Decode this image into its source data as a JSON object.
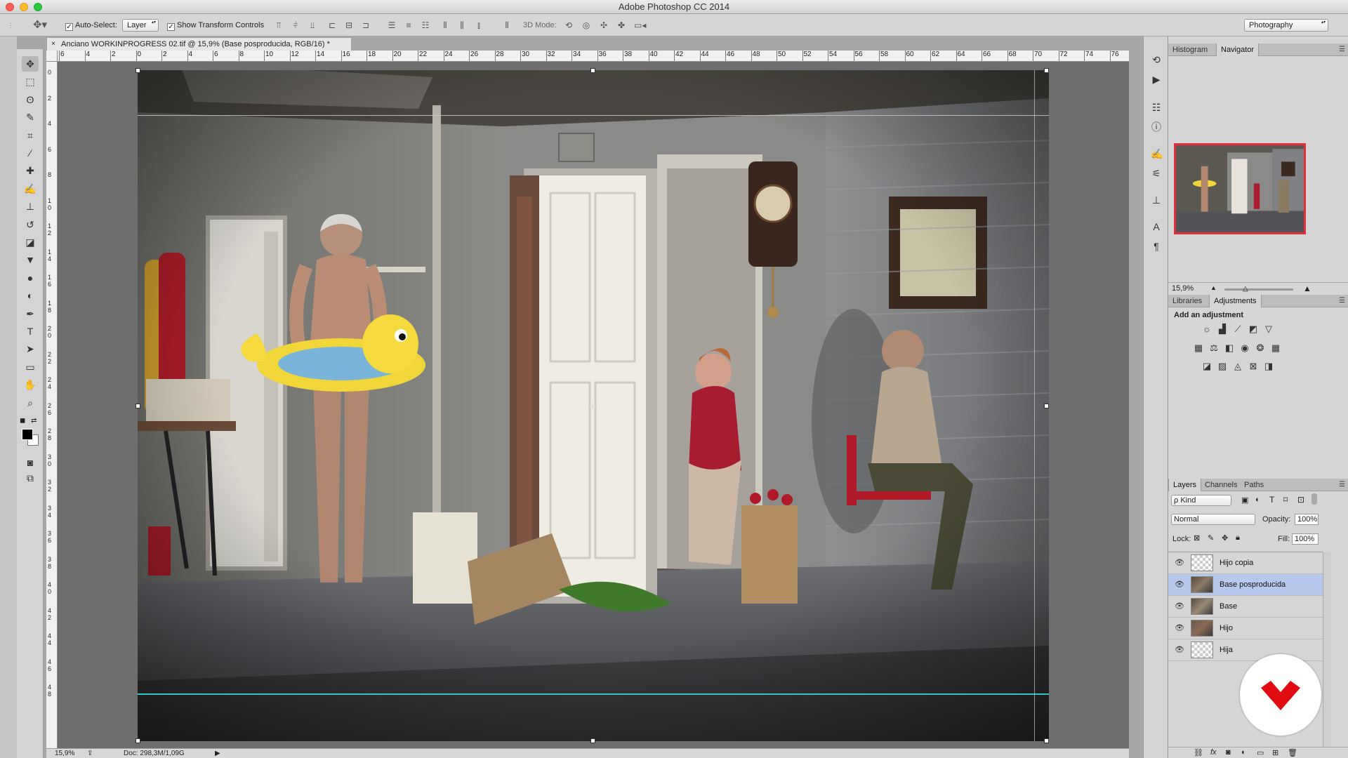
{
  "app": {
    "title": "Adobe Photoshop CC 2014"
  },
  "options_bar": {
    "auto_select_label": "Auto-Select:",
    "auto_select_checked": true,
    "auto_select_target": "Layer",
    "show_transform_label": "Show Transform Controls",
    "show_transform_checked": true,
    "mode_3d_label": "3D Mode:",
    "workspace": "Photography"
  },
  "document": {
    "tab_title": "Anciano WORKINPROGRESS 02.tif @ 15,9% (Base posproducida, RGB/16) *",
    "close_glyph": "×"
  },
  "ruler_h": [
    "6",
    "4",
    "2",
    "0",
    "2",
    "4",
    "6",
    "8",
    "10",
    "12",
    "14",
    "16",
    "18",
    "20",
    "22",
    "24",
    "26",
    "28",
    "30",
    "32",
    "34",
    "36",
    "38",
    "40",
    "42",
    "44",
    "46",
    "48",
    "50",
    "52",
    "54",
    "56",
    "58",
    "60",
    "62",
    "64",
    "66",
    "68",
    "70",
    "72",
    "74",
    "76"
  ],
  "ruler_v": [
    "0",
    "2",
    "4",
    "6",
    "8",
    "1\n0",
    "1\n2",
    "1\n4",
    "1\n6",
    "1\n8",
    "2\n0",
    "2\n2",
    "2\n4",
    "2\n6",
    "2\n8",
    "3\n0",
    "3\n2",
    "3\n4",
    "3\n6",
    "3\n8",
    "4\n0",
    "4\n2",
    "4\n4",
    "4\n6",
    "4\n8"
  ],
  "status_bar": {
    "zoom": "15,9%",
    "doc_info": "Doc: 298,3M/1,09G"
  },
  "tools": [
    {
      "name": "move-tool",
      "glyph": "✥"
    },
    {
      "name": "marquee-tool",
      "glyph": "⬚"
    },
    {
      "name": "lasso-tool",
      "glyph": "ʘ"
    },
    {
      "name": "quick-select-tool",
      "glyph": "✎"
    },
    {
      "name": "crop-tool",
      "glyph": "⌗"
    },
    {
      "name": "eyedropper-tool",
      "glyph": "⁄"
    },
    {
      "name": "healing-tool",
      "glyph": "✚"
    },
    {
      "name": "brush-tool",
      "glyph": "✍"
    },
    {
      "name": "stamp-tool",
      "glyph": "⊥"
    },
    {
      "name": "history-brush-tool",
      "glyph": "↺"
    },
    {
      "name": "eraser-tool",
      "glyph": "◪"
    },
    {
      "name": "paint-bucket-tool",
      "glyph": "▼"
    },
    {
      "name": "blur-tool",
      "glyph": "●"
    },
    {
      "name": "dodge-tool",
      "glyph": "◐"
    },
    {
      "name": "pen-tool",
      "glyph": "✒"
    },
    {
      "name": "type-tool",
      "glyph": "T"
    },
    {
      "name": "path-select-tool",
      "glyph": "➤"
    },
    {
      "name": "rectangle-tool",
      "glyph": "▭"
    },
    {
      "name": "hand-tool",
      "glyph": "✋"
    },
    {
      "name": "zoom-tool",
      "glyph": "⌕"
    }
  ],
  "panels": {
    "top_tabs": [
      "Histogram",
      "Navigator"
    ],
    "top_active": "Navigator",
    "navigator_zoom": "15,9%",
    "mid_tabs": [
      "Libraries",
      "Adjustments"
    ],
    "mid_active": "Adjustments",
    "add_adjustment": "Add an adjustment",
    "layer_tabs": [
      "Layers",
      "Channels",
      "Paths"
    ],
    "layer_active": "Layers",
    "kind_filter": "ρ Kind",
    "blend_mode": "Normal",
    "opacity_label": "Opacity:",
    "opacity_value": "100%",
    "lock_label": "Lock:",
    "fill_label": "Fill:",
    "fill_value": "100%",
    "layers": [
      {
        "name": "Hijo copia",
        "visible": true,
        "selected": false
      },
      {
        "name": "Base posproducida",
        "visible": true,
        "selected": true
      },
      {
        "name": "Base",
        "visible": true,
        "selected": false
      },
      {
        "name": "Hijo",
        "visible": true,
        "selected": false
      },
      {
        "name": "Hija",
        "visible": true,
        "selected": false
      }
    ],
    "bottom_icons": [
      "link-icon",
      "fx-icon",
      "mask-icon",
      "adjustment-layer-icon",
      "group-icon",
      "new-layer-icon",
      "trash-icon"
    ],
    "fx_label": "fx"
  },
  "colors": {
    "selected_layer": "#b6c9ec",
    "navigator_frame": "#e0303a",
    "guide": "#2ec6c8",
    "logo_red": "#e00c12"
  }
}
